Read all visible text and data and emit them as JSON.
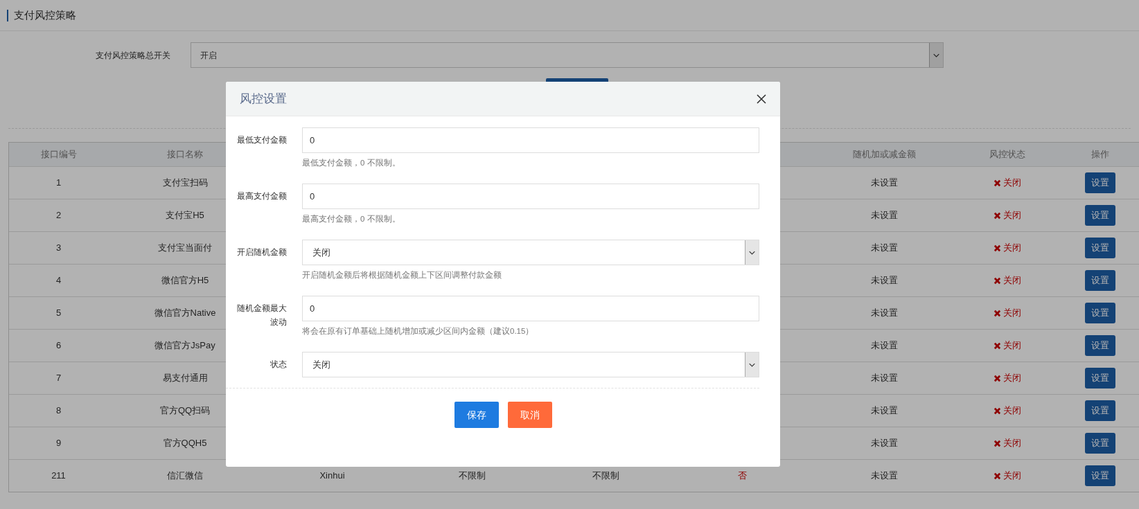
{
  "page": {
    "title": "支付风控策略",
    "master_switch": {
      "label": "支付风控策略总开关",
      "value": "开启"
    }
  },
  "table": {
    "columns": [
      "接口编号",
      "接口名称",
      "随机加或减金额",
      "风控状态",
      "操作"
    ],
    "rows": [
      {
        "id": "1",
        "name": "支付宝扫码",
        "random_amount": "未设置",
        "status": {
          "text": "关闭",
          "on": false
        },
        "action": "设置"
      },
      {
        "id": "2",
        "name": "支付宝H5",
        "random_amount": "未设置",
        "status": {
          "text": "关闭",
          "on": false
        },
        "action": "设置"
      },
      {
        "id": "3",
        "name": "支付宝当面付",
        "random_amount": "未设置",
        "status": {
          "text": "关闭",
          "on": false
        },
        "action": "设置"
      },
      {
        "id": "4",
        "name": "微信官方H5",
        "random_amount": "未设置",
        "status": {
          "text": "关闭",
          "on": false
        },
        "action": "设置"
      },
      {
        "id": "5",
        "name": "微信官方Native",
        "random_amount": "未设置",
        "status": {
          "text": "关闭",
          "on": false
        },
        "action": "设置"
      },
      {
        "id": "6",
        "name": "微信官方JsPay",
        "random_amount": "未设置",
        "status": {
          "text": "关闭",
          "on": false
        },
        "action": "设置"
      },
      {
        "id": "7",
        "name": "易支付通用",
        "random_amount": "未设置",
        "status": {
          "text": "关闭",
          "on": false
        },
        "action": "设置"
      },
      {
        "id": "8",
        "name": "官方QQ扫码",
        "random_amount": "未设置",
        "status": {
          "text": "关闭",
          "on": false
        },
        "action": "设置"
      },
      {
        "id": "9",
        "name": "官方QQH5",
        "random_amount": "未设置",
        "status": {
          "text": "关闭",
          "on": false
        },
        "action": "设置"
      },
      {
        "id": "211",
        "name": "信汇微信",
        "column_3": "Xinhui",
        "column_4": "不限制",
        "column_5": "不限制",
        "column_6": {
          "text": "否",
          "on": false
        },
        "random_amount": "未设置",
        "status": {
          "text": "关闭",
          "on": false
        },
        "action": "设置"
      }
    ]
  },
  "dialog": {
    "title": "风控设置",
    "fields": [
      {
        "kind": "input",
        "label": "最低支付金额",
        "value": "0",
        "help": "最低支付金额，0 不限制。"
      },
      {
        "kind": "input",
        "label": "最高支付金额",
        "value": "0",
        "help": "最高支付金额，0 不限制。"
      },
      {
        "kind": "select",
        "label": "开启随机金额",
        "value": "关闭",
        "help": "开启随机金额后将根据随机金额上下区间调整付款金额"
      },
      {
        "kind": "input",
        "label": "随机金额最大波动",
        "value": "0",
        "help": "将会在原有订单基础上随机增加或减少区间内金额（建议0.15）"
      },
      {
        "kind": "select",
        "label": "状态",
        "value": "关闭"
      }
    ],
    "buttons": [
      {
        "kind": "primary",
        "label": "保存"
      },
      {
        "kind": "danger",
        "label": "取消"
      }
    ]
  }
}
